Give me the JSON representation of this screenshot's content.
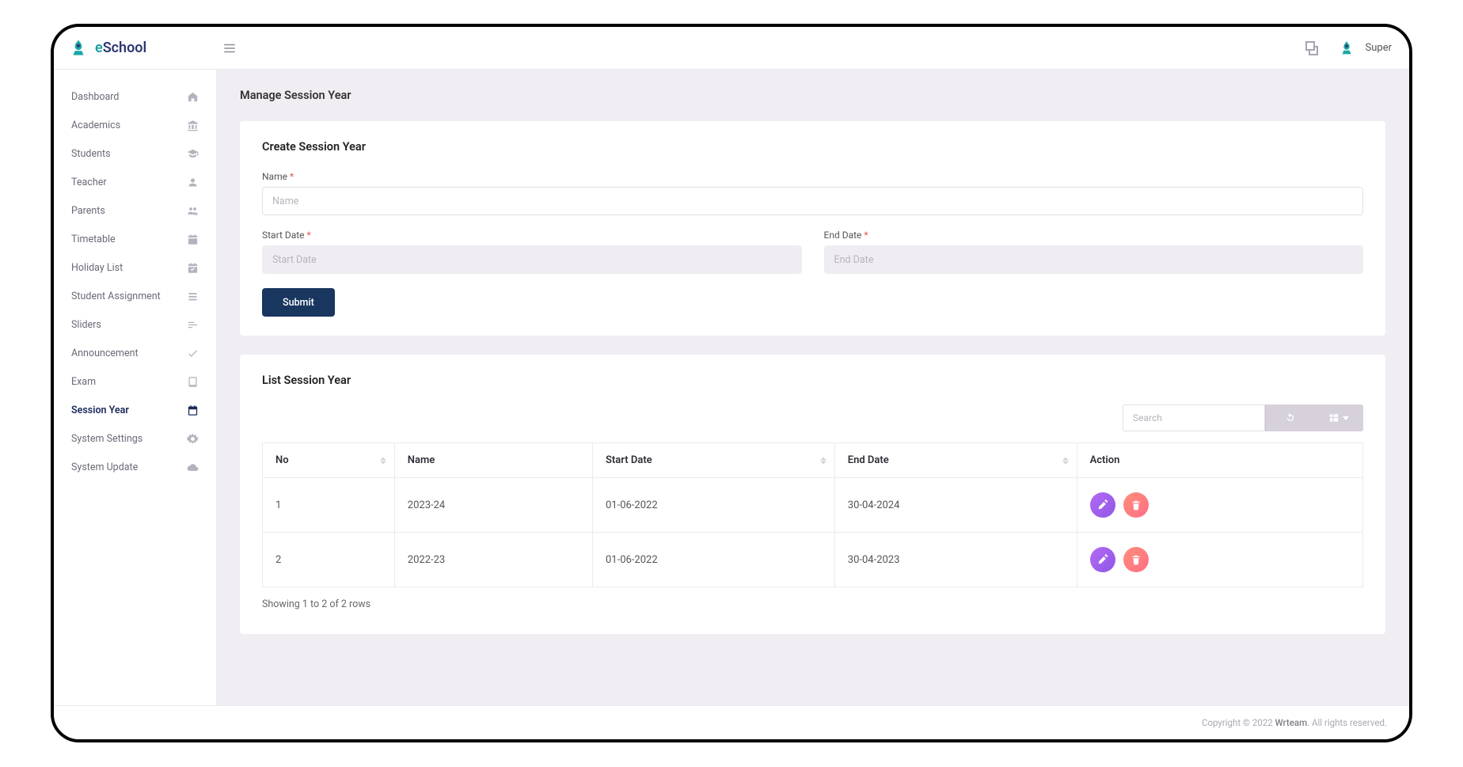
{
  "brand": {
    "e": "e",
    "rest": "School"
  },
  "user": {
    "name": "Super"
  },
  "page": {
    "title": "Manage Session Year"
  },
  "sidebar": {
    "items": [
      {
        "label": "Dashboard",
        "icon": "home"
      },
      {
        "label": "Academics",
        "icon": "institution"
      },
      {
        "label": "Students",
        "icon": "graduation"
      },
      {
        "label": "Teacher",
        "icon": "user"
      },
      {
        "label": "Parents",
        "icon": "users"
      },
      {
        "label": "Timetable",
        "icon": "calendar"
      },
      {
        "label": "Holiday List",
        "icon": "calendar-check"
      },
      {
        "label": "Student Assignment",
        "icon": "list"
      },
      {
        "label": "Sliders",
        "icon": "sliders"
      },
      {
        "label": "Announcement",
        "icon": "check"
      },
      {
        "label": "Exam",
        "icon": "book"
      },
      {
        "label": "Session Year",
        "icon": "calendar-bold",
        "active": true
      },
      {
        "label": "System Settings",
        "icon": "gear"
      },
      {
        "label": "System Update",
        "icon": "cloud"
      }
    ]
  },
  "form": {
    "title": "Create Session Year",
    "name_label": "Name",
    "name_placeholder": "Name",
    "start_label": "Start Date",
    "start_placeholder": "Start Date",
    "end_label": "End Date",
    "end_placeholder": "End Date",
    "submit": "Submit"
  },
  "list": {
    "title": "List Session Year",
    "search_placeholder": "Search",
    "cols": {
      "no": "No",
      "name": "Name",
      "start": "Start Date",
      "end": "End Date",
      "action": "Action"
    },
    "rows": [
      {
        "no": "1",
        "name": "2023-24",
        "start": "01-06-2022",
        "end": "30-04-2024"
      },
      {
        "no": "2",
        "name": "2022-23",
        "start": "01-06-2022",
        "end": "30-04-2023"
      }
    ],
    "info": "Showing 1 to 2 of 2 rows"
  },
  "footer": {
    "prefix": "Copyright © 2022 ",
    "brand": "Wrteam",
    "suffix": ". All rights reserved."
  }
}
